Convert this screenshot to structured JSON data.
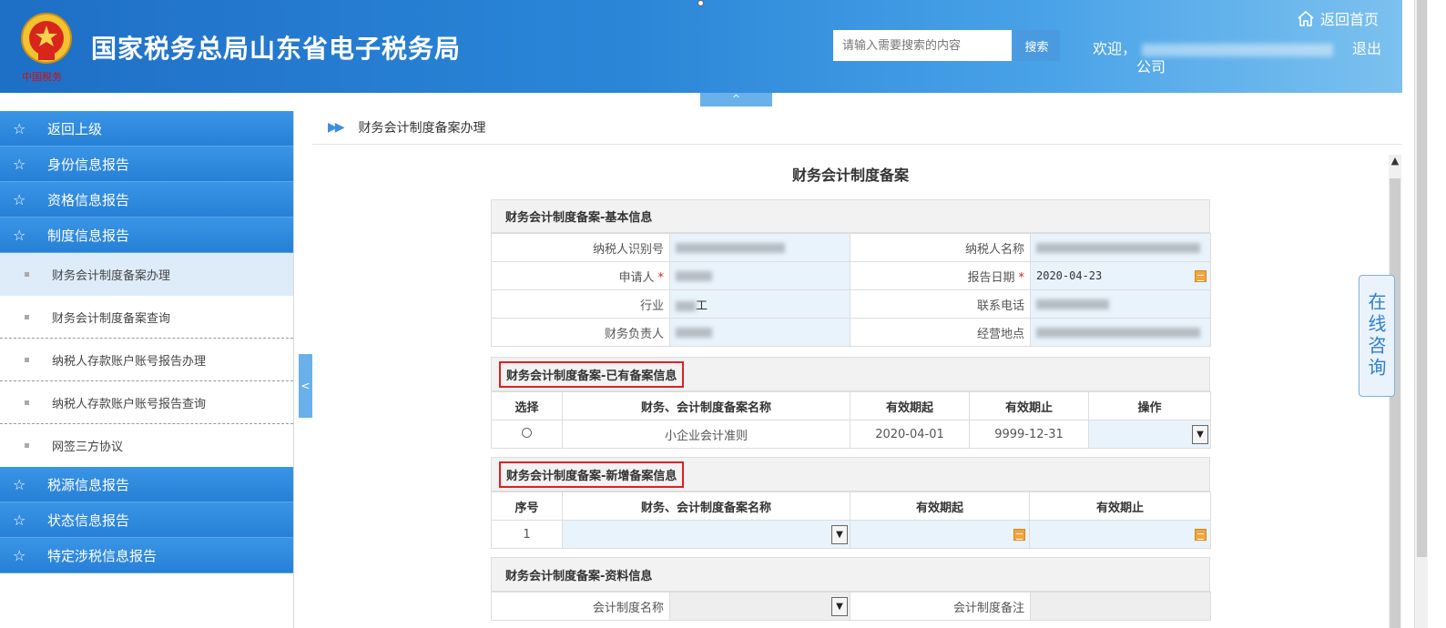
{
  "header": {
    "emblem_subtitle": "中国税务",
    "site_title": "国家税务总局山东省电子税务局",
    "search_placeholder": "请输入需要搜索的内容",
    "search_button": "搜索",
    "home_link": "返回首页",
    "welcome": "欢迎，",
    "company_suffix": "公司",
    "logout": "退出",
    "collapse_tab": "^"
  },
  "sidebar": {
    "top_items": [
      {
        "label": "返回上级"
      },
      {
        "label": "身份信息报告"
      },
      {
        "label": "资格信息报告"
      },
      {
        "label": "制度信息报告"
      }
    ],
    "sub_items": [
      {
        "label": "财务会计制度备案办理",
        "active": true
      },
      {
        "label": "财务会计制度备案查询"
      },
      {
        "label": "纳税人存款账户账号报告办理"
      },
      {
        "label": "纳税人存款账户账号报告查询"
      },
      {
        "label": "网签三方协议"
      }
    ],
    "bottom_items": [
      {
        "label": "税源信息报告"
      },
      {
        "label": "状态信息报告"
      },
      {
        "label": "特定涉税信息报告"
      }
    ],
    "toggle": "<"
  },
  "breadcrumb": {
    "text": "财务会计制度备案办理"
  },
  "form": {
    "title": "财务会计制度备案",
    "basic": {
      "section_title": "财务会计制度备案-基本信息",
      "taxpayer_id_label": "纳税人识别号",
      "taxpayer_name_label": "纳税人名称",
      "applicant_label": "申请人",
      "report_date_label": "报告日期",
      "report_date_value": "2020-04-23",
      "industry_label": "行业",
      "industry_value": "工",
      "phone_label": "联系电话",
      "finance_head_label": "财务负责人",
      "address_label": "经营地点",
      "required_mark": "*"
    },
    "existing": {
      "section_title": "财务会计制度备案-已有备案信息",
      "headers": [
        "选择",
        "财务、会计制度备案名称",
        "有效期起",
        "有效期止",
        "操作"
      ],
      "rows": [
        {
          "name": "小企业会计准则",
          "start": "2020-04-01",
          "end": "9999-12-31"
        }
      ]
    },
    "new": {
      "section_title": "财务会计制度备案-新增备案信息",
      "headers": [
        "序号",
        "财务、会计制度备案名称",
        "有效期起",
        "有效期止"
      ],
      "rows": [
        {
          "seq": "1"
        }
      ]
    },
    "material": {
      "section_title": "财务会计制度备案-资料信息",
      "system_name_label": "会计制度名称",
      "system_note_label": "会计制度备注"
    }
  },
  "consult": {
    "label": "在线咨询"
  },
  "colors": {
    "header_blue": "#2b86d8",
    "menu_blue": "#2f88dc",
    "active_sub": "#deecf9",
    "highlight_red": "#e02020"
  },
  "icons": [
    "emblem-icon",
    "home-icon",
    "star-icon",
    "double-arrow-icon",
    "calendar-icon",
    "dropdown-arrow-icon",
    "radio-icon"
  ]
}
